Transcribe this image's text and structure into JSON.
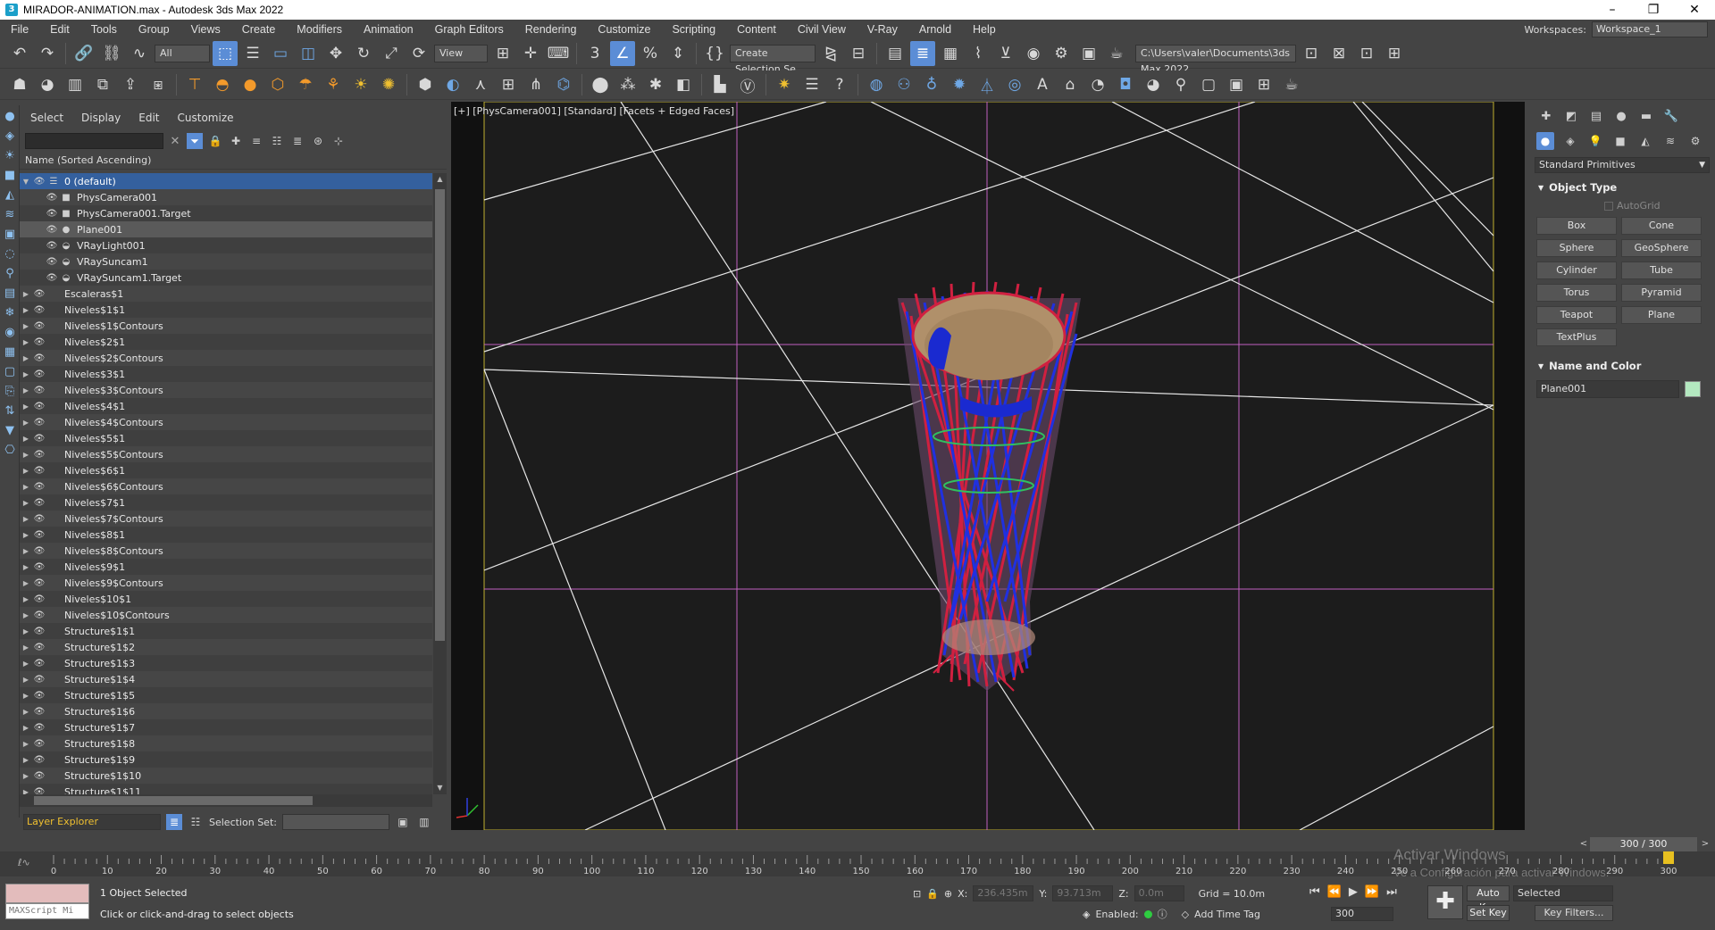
{
  "window": {
    "title": "MIRADOR-ANIMATION.max - Autodesk 3ds Max 2022",
    "controls": [
      "–",
      "❐",
      "✕"
    ]
  },
  "menu": {
    "items": [
      "File",
      "Edit",
      "Tools",
      "Group",
      "Views",
      "Create",
      "Modifiers",
      "Animation",
      "Graph Editors",
      "Rendering",
      "Customize",
      "Scripting",
      "Content",
      "Civil View",
      "V-Ray",
      "Arnold",
      "Help"
    ],
    "workspaces_label": "Workspaces:",
    "workspace_value": "Workspace_1"
  },
  "toolbar1": {
    "filter_value": "All",
    "refcoord_value": "View",
    "selection_set_value": "Create Selection Se",
    "project_path": "C:\\Users\\valer\\Documents\\3ds Max 2022"
  },
  "explorer": {
    "menu": [
      "Select",
      "Display",
      "Edit",
      "Customize"
    ],
    "header": "Name (Sorted Ascending)",
    "rows": [
      {
        "label": "0 (default)",
        "level": 0,
        "expand": "▼",
        "icon": "☰",
        "state": "selected"
      },
      {
        "label": "PhysCamera001",
        "level": 2,
        "expand": "",
        "icon": "■",
        "state": ""
      },
      {
        "label": "PhysCamera001.Target",
        "level": 2,
        "expand": "",
        "icon": "■",
        "state": ""
      },
      {
        "label": "Plane001",
        "level": 2,
        "expand": "",
        "icon": "●",
        "state": "highlight"
      },
      {
        "label": "VRayLight001",
        "level": 2,
        "expand": "",
        "icon": "◒",
        "state": ""
      },
      {
        "label": "VRaySuncam1",
        "level": 2,
        "expand": "",
        "icon": "◒",
        "state": ""
      },
      {
        "label": "VRaySuncam1.Target",
        "level": 2,
        "expand": "",
        "icon": "◒",
        "state": ""
      },
      {
        "label": "Escaleras$1",
        "level": 0,
        "expand": "▶",
        "icon": "",
        "state": ""
      },
      {
        "label": "Niveles$1$1",
        "level": 0,
        "expand": "▶",
        "icon": "",
        "state": ""
      },
      {
        "label": "Niveles$1$Contours",
        "level": 0,
        "expand": "▶",
        "icon": "",
        "state": ""
      },
      {
        "label": "Niveles$2$1",
        "level": 0,
        "expand": "▶",
        "icon": "",
        "state": ""
      },
      {
        "label": "Niveles$2$Contours",
        "level": 0,
        "expand": "▶",
        "icon": "",
        "state": ""
      },
      {
        "label": "Niveles$3$1",
        "level": 0,
        "expand": "▶",
        "icon": "",
        "state": ""
      },
      {
        "label": "Niveles$3$Contours",
        "level": 0,
        "expand": "▶",
        "icon": "",
        "state": ""
      },
      {
        "label": "Niveles$4$1",
        "level": 0,
        "expand": "▶",
        "icon": "",
        "state": ""
      },
      {
        "label": "Niveles$4$Contours",
        "level": 0,
        "expand": "▶",
        "icon": "",
        "state": ""
      },
      {
        "label": "Niveles$5$1",
        "level": 0,
        "expand": "▶",
        "icon": "",
        "state": ""
      },
      {
        "label": "Niveles$5$Contours",
        "level": 0,
        "expand": "▶",
        "icon": "",
        "state": ""
      },
      {
        "label": "Niveles$6$1",
        "level": 0,
        "expand": "▶",
        "icon": "",
        "state": ""
      },
      {
        "label": "Niveles$6$Contours",
        "level": 0,
        "expand": "▶",
        "icon": "",
        "state": ""
      },
      {
        "label": "Niveles$7$1",
        "level": 0,
        "expand": "▶",
        "icon": "",
        "state": ""
      },
      {
        "label": "Niveles$7$Contours",
        "level": 0,
        "expand": "▶",
        "icon": "",
        "state": ""
      },
      {
        "label": "Niveles$8$1",
        "level": 0,
        "expand": "▶",
        "icon": "",
        "state": ""
      },
      {
        "label": "Niveles$8$Contours",
        "level": 0,
        "expand": "▶",
        "icon": "",
        "state": ""
      },
      {
        "label": "Niveles$9$1",
        "level": 0,
        "expand": "▶",
        "icon": "",
        "state": ""
      },
      {
        "label": "Niveles$9$Contours",
        "level": 0,
        "expand": "▶",
        "icon": "",
        "state": ""
      },
      {
        "label": "Niveles$10$1",
        "level": 0,
        "expand": "▶",
        "icon": "",
        "state": ""
      },
      {
        "label": "Niveles$10$Contours",
        "level": 0,
        "expand": "▶",
        "icon": "",
        "state": ""
      },
      {
        "label": "Structure$1$1",
        "level": 0,
        "expand": "▶",
        "icon": "",
        "state": ""
      },
      {
        "label": "Structure$1$2",
        "level": 0,
        "expand": "▶",
        "icon": "",
        "state": ""
      },
      {
        "label": "Structure$1$3",
        "level": 0,
        "expand": "▶",
        "icon": "",
        "state": ""
      },
      {
        "label": "Structure$1$4",
        "level": 0,
        "expand": "▶",
        "icon": "",
        "state": ""
      },
      {
        "label": "Structure$1$5",
        "level": 0,
        "expand": "▶",
        "icon": "",
        "state": ""
      },
      {
        "label": "Structure$1$6",
        "level": 0,
        "expand": "▶",
        "icon": "",
        "state": ""
      },
      {
        "label": "Structure$1$7",
        "level": 0,
        "expand": "▶",
        "icon": "",
        "state": ""
      },
      {
        "label": "Structure$1$8",
        "level": 0,
        "expand": "▶",
        "icon": "",
        "state": ""
      },
      {
        "label": "Structure$1$9",
        "level": 0,
        "expand": "▶",
        "icon": "",
        "state": ""
      },
      {
        "label": "Structure$1$10",
        "level": 0,
        "expand": "▶",
        "icon": "",
        "state": ""
      },
      {
        "label": "Structure$1$11",
        "level": 0,
        "expand": "▶",
        "icon": "",
        "state": ""
      }
    ],
    "bottom_select": "Layer Explorer",
    "selection_set_label": "Selection Set:"
  },
  "viewport": {
    "label": "[+] [PhysCamera001] [Standard] [Facets + Edged Faces]"
  },
  "command_panel": {
    "category": "Standard Primitives",
    "object_type_header": "Object Type",
    "autogrid": "AutoGrid",
    "buttons": [
      "Box",
      "Cone",
      "Sphere",
      "GeoSphere",
      "Cylinder",
      "Tube",
      "Torus",
      "Pyramid",
      "Teapot",
      "Plane",
      "TextPlus"
    ],
    "name_color_header": "Name and Color",
    "object_name": "Plane001",
    "object_color": "#b4e8c0"
  },
  "timeline": {
    "frame_readout": "300 / 300",
    "ticks": [
      "0",
      "10",
      "20",
      "30",
      "40",
      "50",
      "60",
      "70",
      "80",
      "90",
      "100",
      "110",
      "120",
      "130",
      "140",
      "150",
      "160",
      "170",
      "180",
      "190",
      "200",
      "210",
      "220",
      "230",
      "240",
      "250",
      "260",
      "270",
      "280",
      "290",
      "300"
    ]
  },
  "status": {
    "maxscript_placeholder": "MAXScript Mi",
    "objects_selected": "1 Object Selected",
    "prompt": "Click or click-and-drag to select objects",
    "x_label": "X:",
    "x_value": "236.435m",
    "y_label": "Y:",
    "y_value": "93.713m",
    "z_label": "Z:",
    "z_value": "0.0m",
    "grid": "Grid = 10.0m",
    "enabled_label": "Enabled:",
    "add_time_tag": "Add Time Tag",
    "current_frame": "300",
    "auto_key": "Auto Key",
    "set_key": "Set Key",
    "key_mode": "Selected",
    "key_filters": "Key Filters...",
    "watermark_title": "Activar Windows",
    "watermark_sub": "Ve a Configuración para activar Windows."
  }
}
